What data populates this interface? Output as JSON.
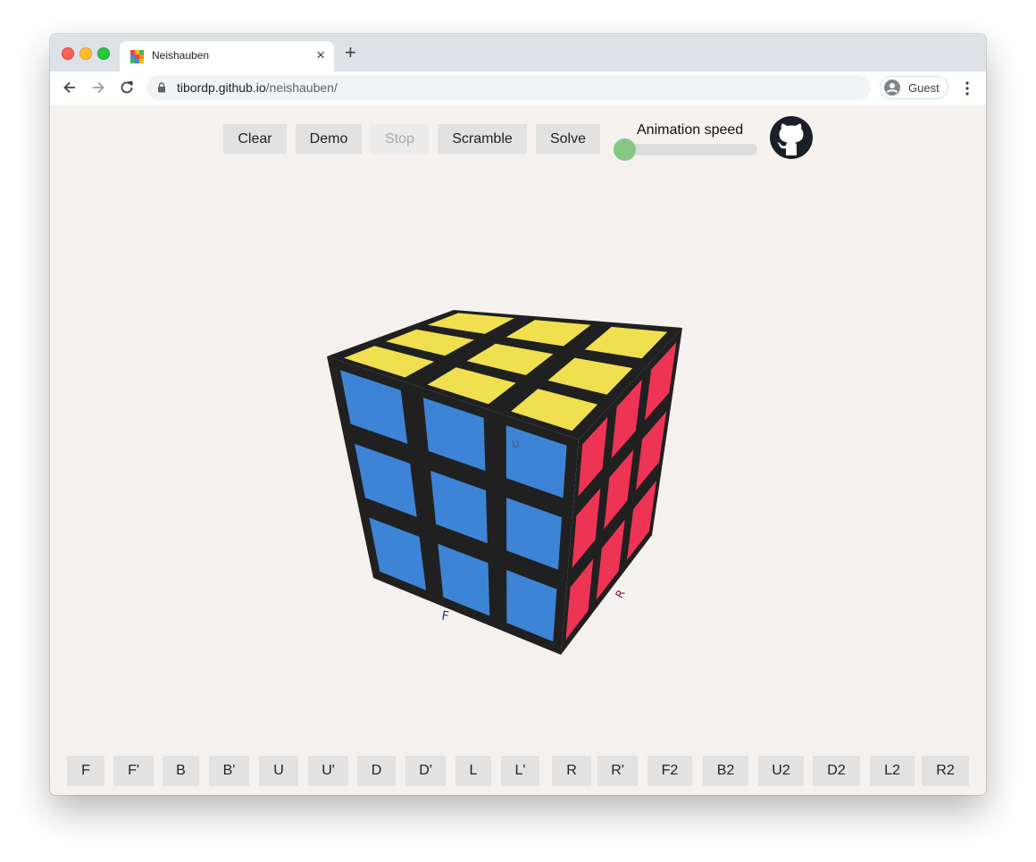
{
  "browser": {
    "tab_title": "Neishauben",
    "tab_close": "×",
    "new_tab": "+",
    "url_host": "tibordp.github.io",
    "url_path": "/neishauben/",
    "profile_label": "Guest"
  },
  "controls": {
    "clear": "Clear",
    "demo": "Demo",
    "stop": "Stop",
    "scramble": "Scramble",
    "solve": "Solve",
    "speed_label": "Animation speed",
    "speed_value": 0
  },
  "cube": {
    "colors": {
      "up": "#f0e050",
      "front": "#3d84d6",
      "right": "#ee3454",
      "edges": "#202020"
    },
    "face_labels": {
      "up": "U",
      "front": "F",
      "right": "R"
    }
  },
  "moves": [
    "F",
    "F'",
    "B",
    "B'",
    "U",
    "U'",
    "D",
    "D'",
    "L",
    "L'",
    "R",
    "R'",
    "F2",
    "B2",
    "U2",
    "D2",
    "L2",
    "R2"
  ],
  "icons": [
    "back-arrow-icon",
    "forward-arrow-icon",
    "reload-icon",
    "lock-icon",
    "profile-icon",
    "menu-dots-icon",
    "github-icon"
  ]
}
